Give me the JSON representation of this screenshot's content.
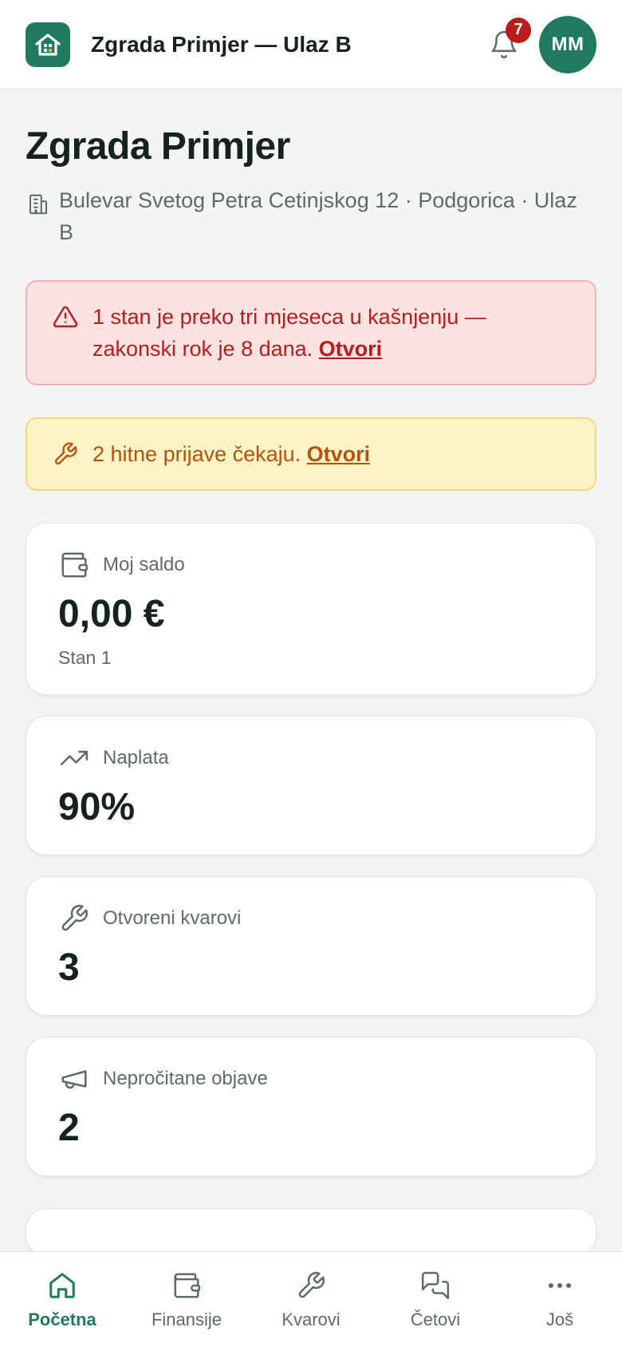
{
  "header": {
    "title": "Zgrada Primjer — Ulaz B",
    "notifications_count": "7",
    "avatar_initials": "MM"
  },
  "page": {
    "title": "Zgrada Primjer",
    "address": "Bulevar Svetog Petra Cetinjskog 12 · Podgorica · Ulaz B"
  },
  "alerts": [
    {
      "text": "1 stan je preko tri mjeseca u kašnjenju — zakonski rok je 8 dana. ",
      "link": "Otvori"
    },
    {
      "text": "2 hitne prijave čekaju. ",
      "link": "Otvori"
    }
  ],
  "cards": [
    {
      "label": "Moj saldo",
      "value": "0,00 €",
      "sub": "Stan 1",
      "icon": "wallet-icon"
    },
    {
      "label": "Naplata",
      "value": "90%",
      "icon": "trending-up-icon"
    },
    {
      "label": "Otvoreni kvarovi",
      "value": "3",
      "icon": "wrench-icon"
    },
    {
      "label": "Nepročitane objave",
      "value": "2",
      "icon": "megaphone-icon"
    }
  ],
  "nav": [
    {
      "label": "Početna",
      "icon": "home-icon",
      "active": true
    },
    {
      "label": "Finansije",
      "icon": "wallet-icon"
    },
    {
      "label": "Kvarovi",
      "icon": "wrench-icon"
    },
    {
      "label": "Četovi",
      "icon": "chat-icon"
    },
    {
      "label": "Još",
      "icon": "more-icon"
    }
  ],
  "colors": {
    "brand": "#1f7a61",
    "danger": "#b91c1c",
    "warning": "#b45309",
    "background": "#f3f4f4"
  }
}
